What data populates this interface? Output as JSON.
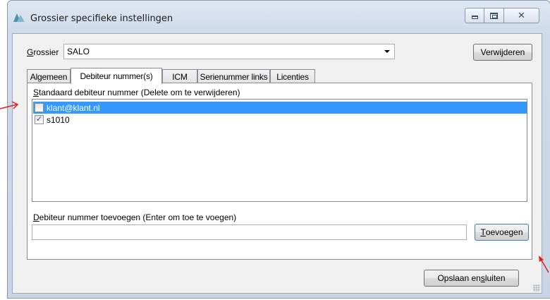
{
  "window": {
    "title": "Grossier specifieke instellingen",
    "icons": {
      "app": "triangles-icon",
      "minimize": "minimize-icon",
      "maximize": "maximize-icon",
      "close": "close-icon"
    },
    "close_glyph": "✕"
  },
  "grossier": {
    "label_prefix": "G",
    "label_rest": "rossier",
    "selected": "SALO",
    "delete_button": "Verwijderen"
  },
  "tabs": [
    {
      "label": "Algemeen",
      "active": false
    },
    {
      "label": "Debiteur nummer(s)",
      "active": true
    },
    {
      "label": "ICM",
      "active": false
    },
    {
      "label": "Serienummer links",
      "active": false
    },
    {
      "label": "Licenties",
      "active": false
    }
  ],
  "debtor_panel": {
    "list_label_prefix": "S",
    "list_label_rest": "tandaard debiteur nummer (Delete om te verwijderen)",
    "items": [
      {
        "text": "klant@klant.nl",
        "checked": false,
        "selected": true
      },
      {
        "text": "s1010",
        "checked": true,
        "selected": false
      }
    ],
    "check_glyph": "✓",
    "add_label_prefix": "D",
    "add_label_rest": "ebiteur nummer toevoegen (Enter om toe te voegen)",
    "add_input_value": "",
    "add_button_prefix": "T",
    "add_button_rest": "oevoegen"
  },
  "footer": {
    "save_prefix": "Opslaan en ",
    "save_underlined": "s",
    "save_suffix": "luiten"
  },
  "colors": {
    "selection": "#3399ff",
    "annotation_arrow": "#e02020"
  }
}
